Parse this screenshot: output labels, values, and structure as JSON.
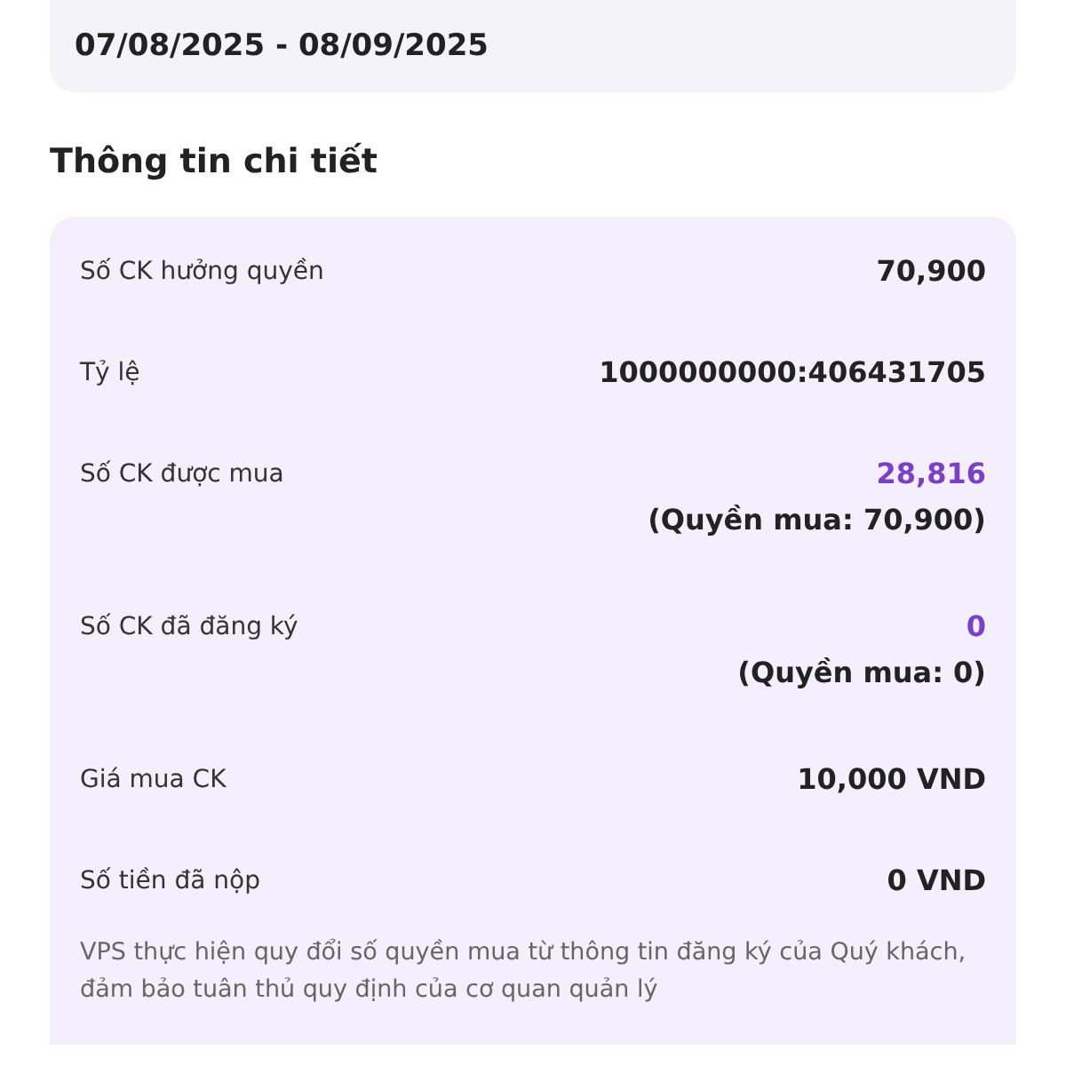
{
  "period": {
    "value": "07/08/2025 - 08/09/2025"
  },
  "details": {
    "title": "Thông tin chi tiết",
    "rows": [
      {
        "label": "Số CK hưởng quyền",
        "value": "70,900",
        "highlighted": false
      },
      {
        "label": "Tỷ lệ",
        "value": "1000000000:406431705",
        "highlighted": false
      },
      {
        "label": "Số CK được mua",
        "value": "28,816",
        "highlighted": true,
        "note": "(Quyền mua: 70,900)"
      },
      {
        "label": "Số CK đã đăng ký",
        "value": "0",
        "highlighted": true,
        "note": "(Quyền mua: 0)"
      },
      {
        "label": "Giá mua CK",
        "value": "10,000 VND",
        "highlighted": false
      },
      {
        "label": "Số tiền đã nộp",
        "value": "0 VND",
        "highlighted": false
      }
    ],
    "notice": "VPS thực hiện quy đổi số quyền mua từ thông tin đăng ký của Quý khách, đảm bảo tuân thủ quy định của cơ quan quản lý"
  }
}
